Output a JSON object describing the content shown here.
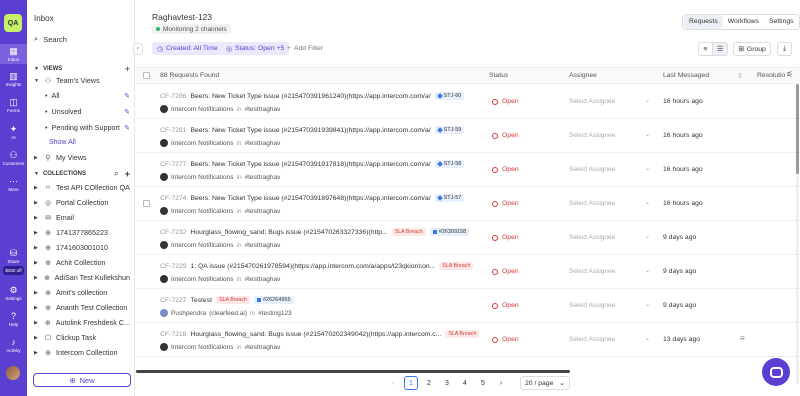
{
  "rail": {
    "logo": "QA",
    "items": [
      {
        "label": "Inbox",
        "icon": "inbox-icon"
      },
      {
        "label": "Insights",
        "icon": "insights-icon"
      },
      {
        "label": "Forms",
        "icon": "forms-icon"
      },
      {
        "label": "AI",
        "icon": "ai-icon"
      },
      {
        "label": "Customers",
        "icon": "customers-icon"
      },
      {
        "label": "More",
        "icon": "more-icon"
      }
    ],
    "bottom": [
      {
        "label": "Share",
        "icon": "share-icon"
      },
      {
        "label": "Settings",
        "icon": "settings-icon"
      },
      {
        "label": "Help",
        "icon": "help-icon"
      },
      {
        "label": "Activity",
        "icon": "activity-icon"
      }
    ],
    "share_badge": "$250 off"
  },
  "sidebar": {
    "title": "Inbox",
    "search": "Search",
    "views_header": "VIEWS",
    "team_views": "Team's Views",
    "views": [
      "All",
      "Unsolved",
      "Pending with Support"
    ],
    "show_all": "Show All",
    "my_views": "My Views",
    "collections_header": "COLLECTIONS",
    "collections": [
      "Test API COllection QA",
      "Portal Collection",
      "Email",
      "1741377865223",
      "1741603001010",
      "Achit Collection",
      "AdiSan Test Kullekshun",
      "Amit's collection",
      "Ananth Test Collection",
      "Autolink Freshdesk C...",
      "Clickup Task",
      "Intercom Collection"
    ],
    "new_button": "New"
  },
  "header": {
    "title": "Raghavtest-123",
    "monitoring": "Monitoring 2 channels",
    "tabs": [
      "Requests",
      "Workflows",
      "Settings"
    ],
    "filters": {
      "created": "Created: All Time",
      "status": "Status: Open +5",
      "add": "Add Filter"
    },
    "group": "Group"
  },
  "table": {
    "count": "88 Requests Found",
    "columns": {
      "status": "Status",
      "assignee": "Assignee",
      "last": "Last Messaged",
      "resolution": "Resolutio"
    },
    "rows": [
      {
        "id": "CF-7286",
        "title": "Beers: New Ticket Type issue (#215470391961240)(https://app.intercom.com/a/",
        "tag": "STJ-60",
        "tag_type": "jira",
        "source": "Intercom Notifications",
        "channel": "#testtraghav",
        "status": "Open",
        "assignee": "Select Assignee",
        "time": "16 hours ago"
      },
      {
        "id": "CF-7281",
        "title": "Beers: New Ticket Type issue (#215470391939841)(https://app.intercom.com/a/",
        "tag": "STJ-59",
        "tag_type": "jira",
        "source": "Intercom Notifications",
        "channel": "#testtraghav",
        "status": "Open",
        "assignee": "Select Assignee",
        "time": "16 hours ago"
      },
      {
        "id": "CF-7277",
        "title": "Beers: New Ticket Type issue (#215470391917818)(https://app.intercom.com/a/",
        "tag": "STJ-58",
        "tag_type": "jira",
        "source": "Intercom Notifications",
        "channel": "#testtraghav",
        "status": "Open",
        "assignee": "Select Assignee",
        "time": "16 hours ago"
      },
      {
        "id": "CF-7274",
        "title": "Beers: New Ticket Type issue (#215470391897648)(https://app.intercom.com/a/",
        "tag": "STJ-57",
        "tag_type": "jira",
        "source": "Intercom Notifications",
        "channel": "#testtraghav",
        "status": "Open",
        "assignee": "Select Assignee",
        "time": "16 hours ago"
      },
      {
        "id": "CF-7232",
        "title": "Hourglass_flowing_sand: Bugs issue (#215470263327336)(http...",
        "sla": "SLA Breach",
        "tag": "#26309158",
        "tag_type": "box",
        "source": "Intercom Notifications",
        "channel": "#testtraghav",
        "status": "Open",
        "assignee": "Select Assignee",
        "time": "9 days ago"
      },
      {
        "id": "CF-7229",
        "title": "1: QA issue (#215470261978594)(https://app.intercom.com/a/apps/l23qkior/con...",
        "sla": "SLA Breach",
        "source": "Intercom Notifications",
        "channel": "#testtraghav",
        "status": "Open",
        "assignee": "Select Assignee",
        "time": "9 days ago"
      },
      {
        "id": "CF-7227",
        "title": "Testest",
        "sla": "SLA Breach",
        "tag": "#26264955",
        "tag_type": "box",
        "source": "Pushpendra",
        "source_extra": "(clearfeed.ai)",
        "channel": "#testing123",
        "status": "Open",
        "assignee": "Select Assignee",
        "time": "9 days ago"
      },
      {
        "id": "CF-7218",
        "title": "Hourglass_flowing_sand: Bugs issue (#215470202349042)(https://app.intercom.c...",
        "sla": "SLA Breach",
        "source": "Intercom Notifications",
        "channel": "#testtraghav",
        "status": "Open",
        "assignee": "Select Assignee",
        "time": "13 days ago"
      }
    ],
    "in_word": "in"
  },
  "pagination": {
    "pages": [
      "1",
      "2",
      "3",
      "4",
      "5"
    ],
    "current": "1",
    "per_page": "20 / page"
  },
  "colors": {
    "accent": "#5b3fd1",
    "open": "#d03b3b",
    "sla_bg": "#fde7e7",
    "tag_bg": "#e8f0fd"
  }
}
